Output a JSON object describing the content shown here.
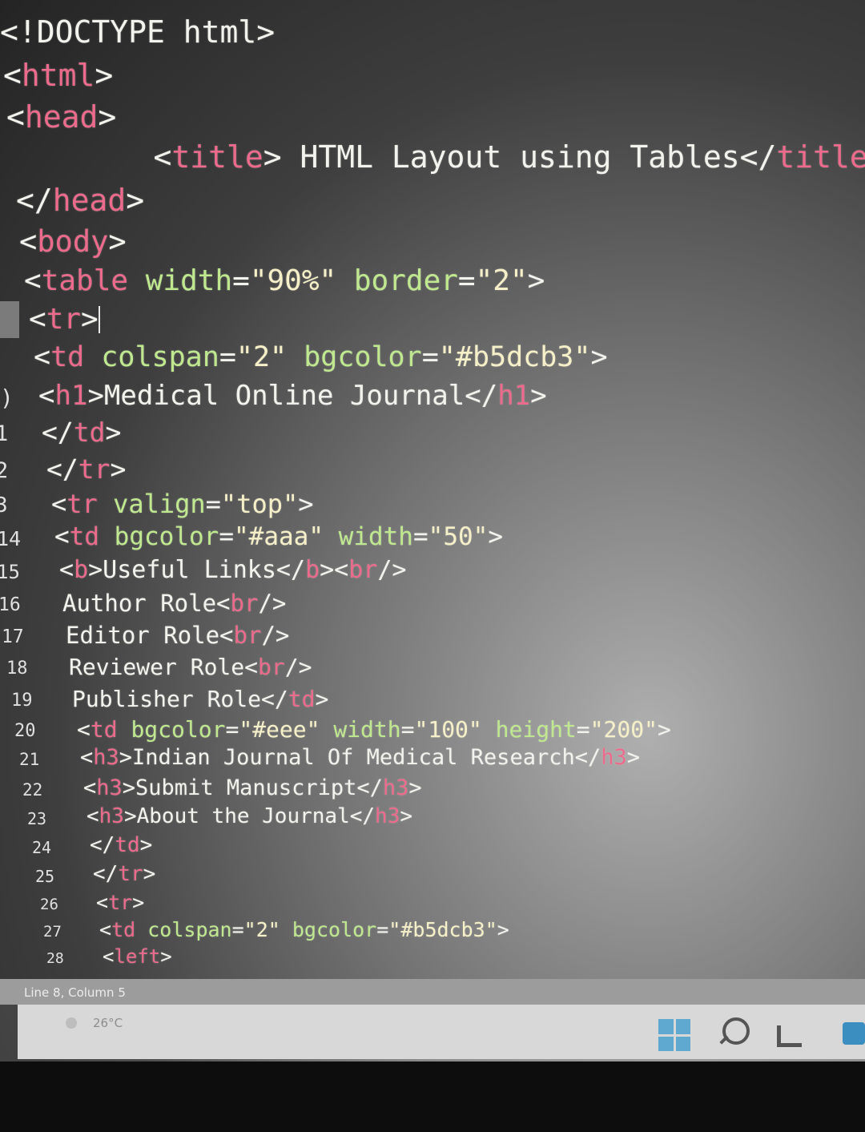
{
  "editor": {
    "lines": [
      {
        "num": "",
        "segs": [
          {
            "c": "t",
            "v": "<!DOCTYPE html>"
          }
        ]
      },
      {
        "num": "",
        "segs": [
          {
            "c": "t",
            "v": "<"
          },
          {
            "c": "k",
            "v": "html"
          },
          {
            "c": "t",
            "v": ">"
          }
        ]
      },
      {
        "num": "",
        "segs": [
          {
            "c": "t",
            "v": "<"
          },
          {
            "c": "k",
            "v": "head"
          },
          {
            "c": "t",
            "v": ">"
          }
        ]
      },
      {
        "num": "",
        "segs": [
          {
            "c": "t",
            "v": "    <"
          },
          {
            "c": "k",
            "v": "title"
          },
          {
            "c": "t",
            "v": "> HTML Layout using Tables</"
          },
          {
            "c": "k",
            "v": "title"
          },
          {
            "c": "t",
            "v": ">"
          }
        ]
      },
      {
        "num": "",
        "segs": [
          {
            "c": "t",
            "v": "</"
          },
          {
            "c": "k",
            "v": "head"
          },
          {
            "c": "t",
            "v": ">"
          }
        ]
      },
      {
        "num": "",
        "segs": [
          {
            "c": "t",
            "v": "<"
          },
          {
            "c": "k",
            "v": "body"
          },
          {
            "c": "t",
            "v": ">"
          }
        ]
      },
      {
        "num": "",
        "segs": [
          {
            "c": "t",
            "v": "<"
          },
          {
            "c": "k",
            "v": "table"
          },
          {
            "c": "t",
            "v": " "
          },
          {
            "c": "a",
            "v": "width"
          },
          {
            "c": "t",
            "v": "="
          },
          {
            "c": "s",
            "v": "\"90%\""
          },
          {
            "c": "t",
            "v": " "
          },
          {
            "c": "a",
            "v": "border"
          },
          {
            "c": "t",
            "v": "="
          },
          {
            "c": "s",
            "v": "\"2\""
          },
          {
            "c": "t",
            "v": ">"
          }
        ]
      },
      {
        "num": "",
        "segs": [
          {
            "c": "t",
            "v": "<"
          },
          {
            "c": "k",
            "v": "tr"
          },
          {
            "c": "t",
            "v": ">"
          }
        ],
        "caret": true
      },
      {
        "num": "",
        "segs": [
          {
            "c": "t",
            "v": "<"
          },
          {
            "c": "k",
            "v": "td"
          },
          {
            "c": "t",
            "v": " "
          },
          {
            "c": "a",
            "v": "colspan"
          },
          {
            "c": "t",
            "v": "="
          },
          {
            "c": "s",
            "v": "\"2\""
          },
          {
            "c": "t",
            "v": " "
          },
          {
            "c": "a",
            "v": "bgcolor"
          },
          {
            "c": "t",
            "v": "="
          },
          {
            "c": "s",
            "v": "\"#b5dcb3\""
          },
          {
            "c": "t",
            "v": ">"
          }
        ]
      },
      {
        "num": ")",
        "segs": [
          {
            "c": "t",
            "v": "<"
          },
          {
            "c": "k",
            "v": "h1"
          },
          {
            "c": "t",
            "v": ">Medical Online Journal</"
          },
          {
            "c": "k",
            "v": "h1"
          },
          {
            "c": "t",
            "v": ">"
          }
        ]
      },
      {
        "num": "1",
        "segs": [
          {
            "c": "t",
            "v": "</"
          },
          {
            "c": "k",
            "v": "td"
          },
          {
            "c": "t",
            "v": ">"
          }
        ]
      },
      {
        "num": "2",
        "segs": [
          {
            "c": "t",
            "v": "</"
          },
          {
            "c": "k",
            "v": "tr"
          },
          {
            "c": "t",
            "v": ">"
          }
        ]
      },
      {
        "num": "3",
        "segs": [
          {
            "c": "t",
            "v": "<"
          },
          {
            "c": "k",
            "v": "tr"
          },
          {
            "c": "t",
            "v": " "
          },
          {
            "c": "a",
            "v": "valign"
          },
          {
            "c": "t",
            "v": "="
          },
          {
            "c": "s",
            "v": "\"top\""
          },
          {
            "c": "t",
            "v": ">"
          }
        ]
      },
      {
        "num": "14",
        "segs": [
          {
            "c": "t",
            "v": "<"
          },
          {
            "c": "k",
            "v": "td"
          },
          {
            "c": "t",
            "v": " "
          },
          {
            "c": "a",
            "v": "bgcolor"
          },
          {
            "c": "t",
            "v": "="
          },
          {
            "c": "s",
            "v": "\"#aaa\""
          },
          {
            "c": "t",
            "v": " "
          },
          {
            "c": "a",
            "v": "width"
          },
          {
            "c": "t",
            "v": "="
          },
          {
            "c": "s",
            "v": "\"50\""
          },
          {
            "c": "t",
            "v": ">"
          }
        ]
      },
      {
        "num": "15",
        "segs": [
          {
            "c": "t",
            "v": "<"
          },
          {
            "c": "k",
            "v": "b"
          },
          {
            "c": "t",
            "v": ">Useful Links</"
          },
          {
            "c": "k",
            "v": "b"
          },
          {
            "c": "t",
            "v": "><"
          },
          {
            "c": "k",
            "v": "br"
          },
          {
            "c": "t",
            "v": "/>"
          }
        ]
      },
      {
        "num": "16",
        "segs": [
          {
            "c": "t",
            "v": "Author Role<"
          },
          {
            "c": "k",
            "v": "br"
          },
          {
            "c": "t",
            "v": "/>"
          }
        ]
      },
      {
        "num": "17",
        "segs": [
          {
            "c": "t",
            "v": "Editor Role<"
          },
          {
            "c": "k",
            "v": "br"
          },
          {
            "c": "t",
            "v": "/>"
          }
        ]
      },
      {
        "num": "18",
        "segs": [
          {
            "c": "t",
            "v": "Reviewer Role<"
          },
          {
            "c": "k",
            "v": "br"
          },
          {
            "c": "t",
            "v": "/>"
          }
        ]
      },
      {
        "num": "19",
        "segs": [
          {
            "c": "t",
            "v": "Publisher Role</"
          },
          {
            "c": "k",
            "v": "td"
          },
          {
            "c": "t",
            "v": ">"
          }
        ]
      },
      {
        "num": "20",
        "segs": [
          {
            "c": "t",
            "v": "<"
          },
          {
            "c": "k",
            "v": "td"
          },
          {
            "c": "t",
            "v": " "
          },
          {
            "c": "a",
            "v": "bgcolor"
          },
          {
            "c": "t",
            "v": "="
          },
          {
            "c": "s",
            "v": "\"#eee\""
          },
          {
            "c": "t",
            "v": " "
          },
          {
            "c": "a",
            "v": "width"
          },
          {
            "c": "t",
            "v": "="
          },
          {
            "c": "s",
            "v": "\"100\""
          },
          {
            "c": "t",
            "v": " "
          },
          {
            "c": "a",
            "v": "height"
          },
          {
            "c": "t",
            "v": "="
          },
          {
            "c": "s",
            "v": "\"200\""
          },
          {
            "c": "t",
            "v": ">"
          }
        ]
      },
      {
        "num": "21",
        "segs": [
          {
            "c": "t",
            "v": "<"
          },
          {
            "c": "k",
            "v": "h3"
          },
          {
            "c": "t",
            "v": ">Indian Journal Of Medical Research</"
          },
          {
            "c": "k",
            "v": "h3"
          },
          {
            "c": "t",
            "v": ">"
          }
        ]
      },
      {
        "num": "22",
        "segs": [
          {
            "c": "t",
            "v": "<"
          },
          {
            "c": "k",
            "v": "h3"
          },
          {
            "c": "t",
            "v": ">Submit Manuscript</"
          },
          {
            "c": "k",
            "v": "h3"
          },
          {
            "c": "t",
            "v": ">"
          }
        ]
      },
      {
        "num": "23",
        "segs": [
          {
            "c": "t",
            "v": "<"
          },
          {
            "c": "k",
            "v": "h3"
          },
          {
            "c": "t",
            "v": ">About the Journal</"
          },
          {
            "c": "k",
            "v": "h3"
          },
          {
            "c": "t",
            "v": ">"
          }
        ]
      },
      {
        "num": "24",
        "segs": [
          {
            "c": "t",
            "v": "</"
          },
          {
            "c": "k",
            "v": "td"
          },
          {
            "c": "t",
            "v": ">"
          }
        ]
      },
      {
        "num": "25",
        "segs": [
          {
            "c": "t",
            "v": "</"
          },
          {
            "c": "k",
            "v": "tr"
          },
          {
            "c": "t",
            "v": ">"
          }
        ]
      },
      {
        "num": "26",
        "segs": [
          {
            "c": "t",
            "v": "<"
          },
          {
            "c": "k",
            "v": "tr"
          },
          {
            "c": "t",
            "v": ">"
          }
        ]
      },
      {
        "num": "27",
        "segs": [
          {
            "c": "t",
            "v": "<"
          },
          {
            "c": "k",
            "v": "td"
          },
          {
            "c": "t",
            "v": " "
          },
          {
            "c": "a",
            "v": "colspan"
          },
          {
            "c": "t",
            "v": "="
          },
          {
            "c": "s",
            "v": "\"2\""
          },
          {
            "c": "t",
            "v": " "
          },
          {
            "c": "a",
            "v": "bgcolor"
          },
          {
            "c": "t",
            "v": "="
          },
          {
            "c": "s",
            "v": "\"#b5dcb3\""
          },
          {
            "c": "t",
            "v": ">"
          }
        ]
      },
      {
        "num": "28",
        "segs": [
          {
            "c": "t",
            "v": "<"
          },
          {
            "c": "k",
            "v": "left"
          },
          {
            "c": "t",
            "v": ">"
          }
        ]
      }
    ]
  },
  "status": {
    "position": "Line 8, Column 5"
  },
  "taskbar": {
    "weather_temp": "26°C",
    "icons": [
      "windows-start-icon",
      "search-icon",
      "task-view-icon",
      "browser-icon"
    ]
  },
  "colors": {
    "tag": "#ec6b8c",
    "attr": "#bfe88f",
    "string": "#f6f0c8",
    "text": "#f3f3ee"
  }
}
